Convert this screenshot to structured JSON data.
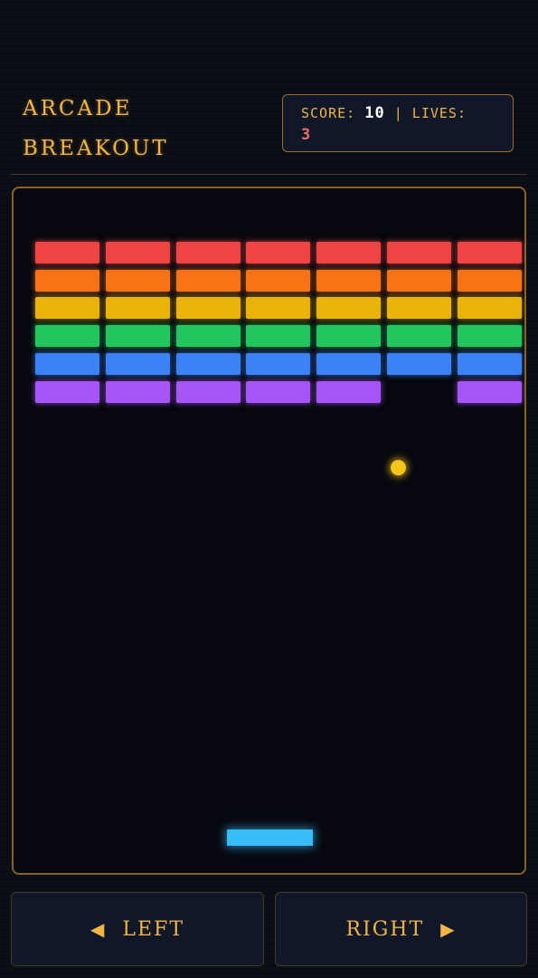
{
  "header": {
    "title_line1": "ARCADE",
    "title_line2": "BREAKOUT",
    "score_label": "SCORE:",
    "score_value": "10",
    "separator": "|",
    "lives_label": "LIVES:",
    "lives_value": "3"
  },
  "game": {
    "columns": 7,
    "rows": [
      {
        "color": "#ef4444",
        "present": [
          1,
          1,
          1,
          1,
          1,
          1,
          1
        ]
      },
      {
        "color": "#f97316",
        "present": [
          1,
          1,
          1,
          1,
          1,
          1,
          1
        ]
      },
      {
        "color": "#eab308",
        "present": [
          1,
          1,
          1,
          1,
          1,
          1,
          1
        ]
      },
      {
        "color": "#22c55e",
        "present": [
          1,
          1,
          1,
          1,
          1,
          1,
          1
        ]
      },
      {
        "color": "#3b82f6",
        "present": [
          1,
          1,
          1,
          1,
          1,
          1,
          1
        ]
      },
      {
        "color": "#a855f7",
        "present": [
          1,
          1,
          1,
          1,
          1,
          0,
          1
        ]
      }
    ],
    "ball_color": "#facc15",
    "paddle_color": "#38bdf8"
  },
  "controls": {
    "left_label": "LEFT",
    "left_icon": "triangle-left-icon",
    "right_label": "RIGHT",
    "right_icon": "triangle-right-icon"
  },
  "colors": {
    "accent": "#f2b544",
    "background": "#0b0d14",
    "border": "#8a6127"
  }
}
